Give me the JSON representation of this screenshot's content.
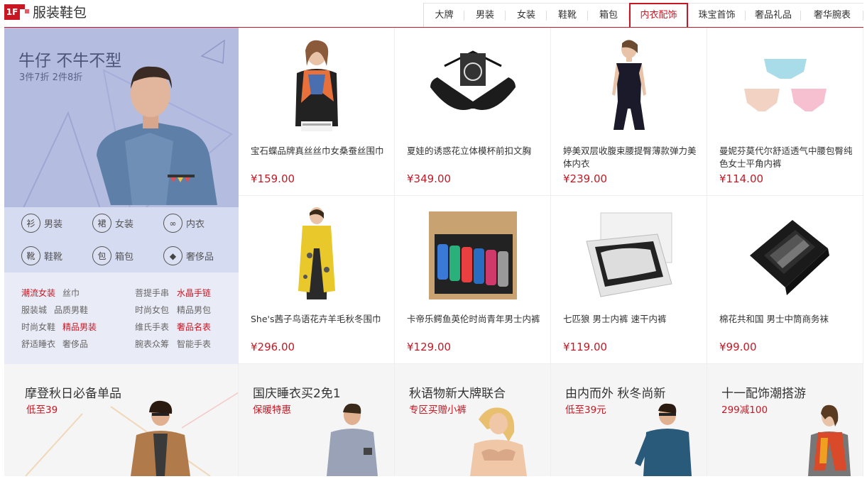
{
  "floor": {
    "badge": "1F",
    "title": "服装鞋包"
  },
  "tabs": [
    {
      "label": "大牌"
    },
    {
      "label": "男装"
    },
    {
      "label": "女装"
    },
    {
      "label": "鞋靴"
    },
    {
      "label": "箱包"
    },
    {
      "label": "内衣配饰",
      "active": true
    },
    {
      "label": "珠宝首饰"
    },
    {
      "label": "奢品礼品"
    },
    {
      "label": "奢华腕表"
    }
  ],
  "hero": {
    "title": "牛仔 不牛不型",
    "subtitle": "3件7折 2件8折"
  },
  "categories": [
    {
      "label": "男装",
      "icon": "shirt-icon",
      "glyph": "衫"
    },
    {
      "label": "女装",
      "icon": "dress-icon",
      "glyph": "裙"
    },
    {
      "label": "内衣",
      "icon": "bra-icon",
      "glyph": "∞"
    },
    {
      "label": "鞋靴",
      "icon": "boot-icon",
      "glyph": "靴"
    },
    {
      "label": "箱包",
      "icon": "bag-icon",
      "glyph": "包"
    },
    {
      "label": "奢侈品",
      "icon": "diamond-icon",
      "glyph": "◆"
    }
  ],
  "links": [
    {
      "label": "潮流女装",
      "highlight": true
    },
    {
      "label": "丝巾"
    },
    {
      "label": "服装城"
    },
    {
      "label": "品质男鞋"
    },
    {
      "label": "时尚女鞋"
    },
    {
      "label": "精品男装",
      "highlight": true
    },
    {
      "label": "舒适睡衣"
    },
    {
      "label": "奢侈品"
    },
    {
      "label": "菩提手串"
    },
    {
      "label": "水晶手链",
      "highlight": true
    },
    {
      "label": "时尚女包"
    },
    {
      "label": "精品男包"
    },
    {
      "label": "维氏手表"
    },
    {
      "label": "奢品名表",
      "highlight": true
    },
    {
      "label": "腕表众筹"
    },
    {
      "label": "智能手表"
    }
  ],
  "products": [
    {
      "name": "宝石蝶品牌真丝丝巾女桑蚕丝围巾",
      "price": "¥159.00",
      "icon": "scarf-model-image"
    },
    {
      "name": "夏娃的诱惑花立体模杯前扣文胸",
      "price": "¥349.00",
      "icon": "bra-image"
    },
    {
      "name": "婷美双层收腹束腰提臀薄款弹力美体内衣",
      "price": "¥239.00",
      "icon": "shapewear-image"
    },
    {
      "name": "曼妮芬莫代尔舒适透气中腰包臀纯色女士平角内裤",
      "price": "¥114.00",
      "icon": "panties-image"
    },
    {
      "name": "She's茜子鸟语花卉羊毛秋冬围巾",
      "price": "¥296.00",
      "icon": "yellow-scarf-image"
    },
    {
      "name": "卡帝乐鳄鱼英伦时尚青年男士内裤",
      "price": "¥129.00",
      "icon": "underwear-box-image"
    },
    {
      "name": "七匹狼 男士内裤 速干内裤",
      "price": "¥119.00",
      "icon": "briefs-box-image"
    },
    {
      "name": "棉花共和国 男士中筒商务袜",
      "price": "¥99.00",
      "icon": "socks-box-image"
    }
  ],
  "promos": [
    {
      "title": "摩登秋日必备单品",
      "subtitle": "低至39",
      "icon": "coat-model-image"
    },
    {
      "title": "国庆睡衣买2免1",
      "subtitle": "保暖特惠",
      "icon": "pajama-model-image"
    },
    {
      "title": "秋语物新大牌联合",
      "subtitle": "专区买赠小裤",
      "icon": "lingerie-model-image"
    },
    {
      "title": "由内而外  秋冬尚新",
      "subtitle": "低至39元",
      "icon": "thermal-model-image"
    },
    {
      "title": "十一配饰潮搭游",
      "subtitle": "299减100",
      "icon": "scarf-promo-image"
    }
  ],
  "colors": {
    "accent": "#c81623",
    "hero_bg": "#b4bce0"
  }
}
